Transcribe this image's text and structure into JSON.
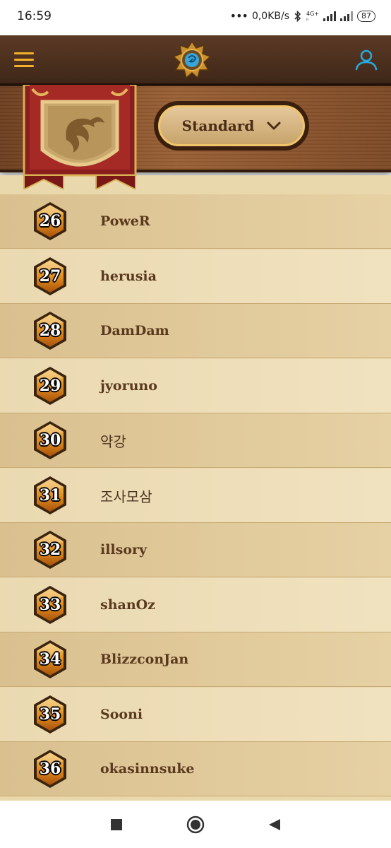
{
  "status": {
    "time": "16:59",
    "net_speed": "0,0KB/s",
    "net_tag_top": "4G+",
    "net_tag_bottom": "ᵢₗ",
    "battery": "87"
  },
  "header": {
    "menu_icon": "hamburger-menu-icon",
    "logo_icon": "hearthstone-logo-icon",
    "user_icon": "user-account-icon"
  },
  "mode_selector": {
    "label": "Standard",
    "icon": "chevron-down-icon"
  },
  "leaderboard": [
    {
      "rank": "26",
      "name": "PoweR"
    },
    {
      "rank": "27",
      "name": "herusia"
    },
    {
      "rank": "28",
      "name": "DamDam"
    },
    {
      "rank": "29",
      "name": "jyoruno"
    },
    {
      "rank": "30",
      "name": "약강"
    },
    {
      "rank": "31",
      "name": "조사모삼"
    },
    {
      "rank": "32",
      "name": "illsory"
    },
    {
      "rank": "33",
      "name": "shanOz"
    },
    {
      "rank": "34",
      "name": "BlizzconJan"
    },
    {
      "rank": "35",
      "name": "Sooni"
    },
    {
      "rank": "36",
      "name": "okasinnsuke"
    }
  ],
  "colors": {
    "accent": "#f3b12b",
    "user_icon": "#29a8e0",
    "wood": "#8a5530",
    "parchment": "#ead8ad"
  }
}
